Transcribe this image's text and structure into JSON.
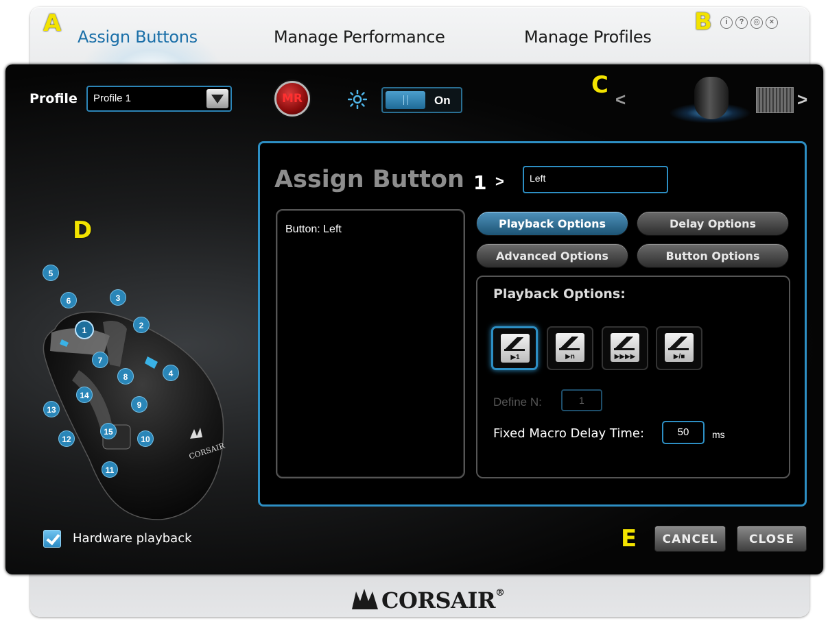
{
  "tabs": [
    {
      "label": "Assign Buttons",
      "active": true
    },
    {
      "label": "Manage Performance",
      "active": false
    },
    {
      "label": "Manage Profiles",
      "active": false
    }
  ],
  "callouts": {
    "a": "A",
    "b": "B",
    "c": "C",
    "d": "D",
    "e": "E"
  },
  "window_icons": [
    "info-icon",
    "help-icon",
    "globe-icon",
    "close-icon"
  ],
  "window_icon_glyphs": [
    "i",
    "?",
    "◎",
    "×"
  ],
  "toolbar": {
    "profile_label": "Profile",
    "profile_value": "Profile 1",
    "mr_label": "MR",
    "toggle_label": "On",
    "device_prev": "<",
    "device_next": ">"
  },
  "mouse_buttons": [
    "1",
    "2",
    "3",
    "4",
    "5",
    "6",
    "7",
    "8",
    "9",
    "10",
    "11",
    "12",
    "13",
    "14",
    "15"
  ],
  "selected_button": "1",
  "hardware_playback": {
    "label": "Hardware playback",
    "checked": true
  },
  "assign": {
    "title": "Assign Button",
    "button_number": "1",
    "chevron": ">",
    "name_value": "Left",
    "list_items": [
      "Button: Left"
    ]
  },
  "option_tabs": [
    {
      "label": "Playback Options",
      "active": true
    },
    {
      "label": "Delay Options",
      "active": false
    },
    {
      "label": "Advanced Options",
      "active": false
    },
    {
      "label": "Button Options",
      "active": false
    }
  ],
  "playback": {
    "title": "Playback Options:",
    "modes": [
      {
        "icon": "play-once-icon",
        "label": "▶1",
        "selected": true
      },
      {
        "icon": "play-n-times-icon",
        "label": "▶n",
        "selected": false
      },
      {
        "icon": "play-repeat-icon",
        "label": "▶▶▶▶",
        "selected": false
      },
      {
        "icon": "play-toggle-icon",
        "label": "▶/■",
        "selected": false
      }
    ],
    "define_n_label": "Define N:",
    "define_n_value": "1",
    "delay_label": "Fixed Macro Delay Time:",
    "delay_value": "50",
    "delay_unit": "ms"
  },
  "footer": {
    "cancel": "CANCEL",
    "close": "CLOSE",
    "brand": "CORSAIR",
    "brand_mark": "®"
  },
  "colors": {
    "accent": "#2d8fc4",
    "callout": "#f3e300",
    "mr": "#d63a3a"
  }
}
